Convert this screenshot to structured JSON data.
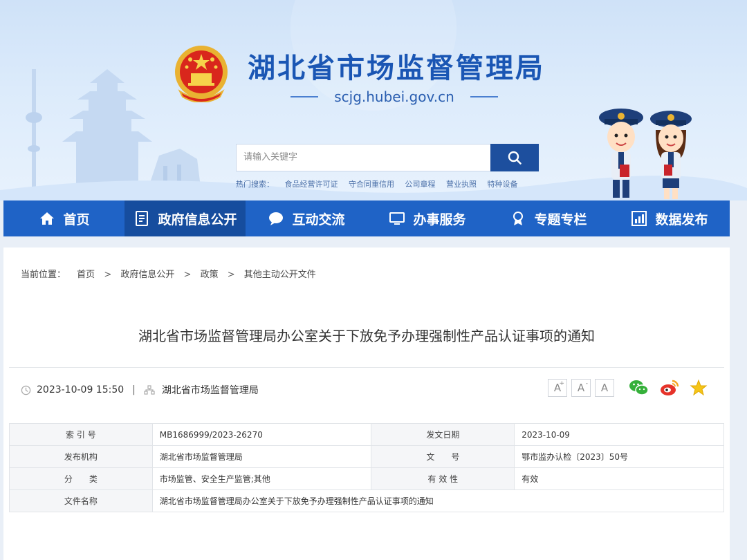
{
  "header": {
    "site_title": "湖北省市场监督管理局",
    "site_url": "scjg.hubei.gov.cn",
    "search_placeholder": "请输入关键字",
    "hot_label": "热门搜索：",
    "hot_terms": [
      "食品经营许可证",
      "守合同重信用",
      "公司章程",
      "营业执照",
      "特种设备"
    ],
    "colors": {
      "title": "#1a56b4",
      "nav": "#1f63c6",
      "nav_active": "#164d9e",
      "search_button": "#1d4f9e"
    }
  },
  "nav": {
    "items": [
      {
        "label": "首页",
        "icon": "home-icon"
      },
      {
        "label": "政府信息公开",
        "icon": "document-list-icon"
      },
      {
        "label": "互动交流",
        "icon": "chat-bubble-icon"
      },
      {
        "label": "办事服务",
        "icon": "monitor-icon"
      },
      {
        "label": "专题专栏",
        "icon": "award-ribbon-icon"
      },
      {
        "label": "数据发布",
        "icon": "bar-chart-icon"
      }
    ]
  },
  "breadcrumb": {
    "label": "当前位置：",
    "items": [
      "首页",
      "政府信息公开",
      "政策",
      "其他主动公开文件"
    ],
    "separator": ">"
  },
  "article": {
    "title": "湖北省市场监督管理局办公室关于下放免予办理强制性产品认证事项的通知",
    "datetime": "2023-10-09 15:50",
    "source": "湖北省市场监督管理局",
    "font_sizes": [
      "A",
      "A",
      "A"
    ]
  },
  "info_table": {
    "rows": [
      {
        "k1": "索 引 号",
        "v1": "MB1686999/2023-26270",
        "k2": "发文日期",
        "v2": "2023-10-09"
      },
      {
        "k1": "发布机构",
        "v1": "湖北省市场监督管理局",
        "k2": "文　　号",
        "v2": "鄂市监办认检〔2023〕50号"
      },
      {
        "k1": "分　　类",
        "v1": "市场监管、安全生产监管;其他",
        "k2": "有 效 性",
        "v2": "有效"
      },
      {
        "k1": "文件名称",
        "v1": "湖北省市场监督管理局办公室关于下放免予办理强制性产品认证事项的通知"
      }
    ]
  }
}
